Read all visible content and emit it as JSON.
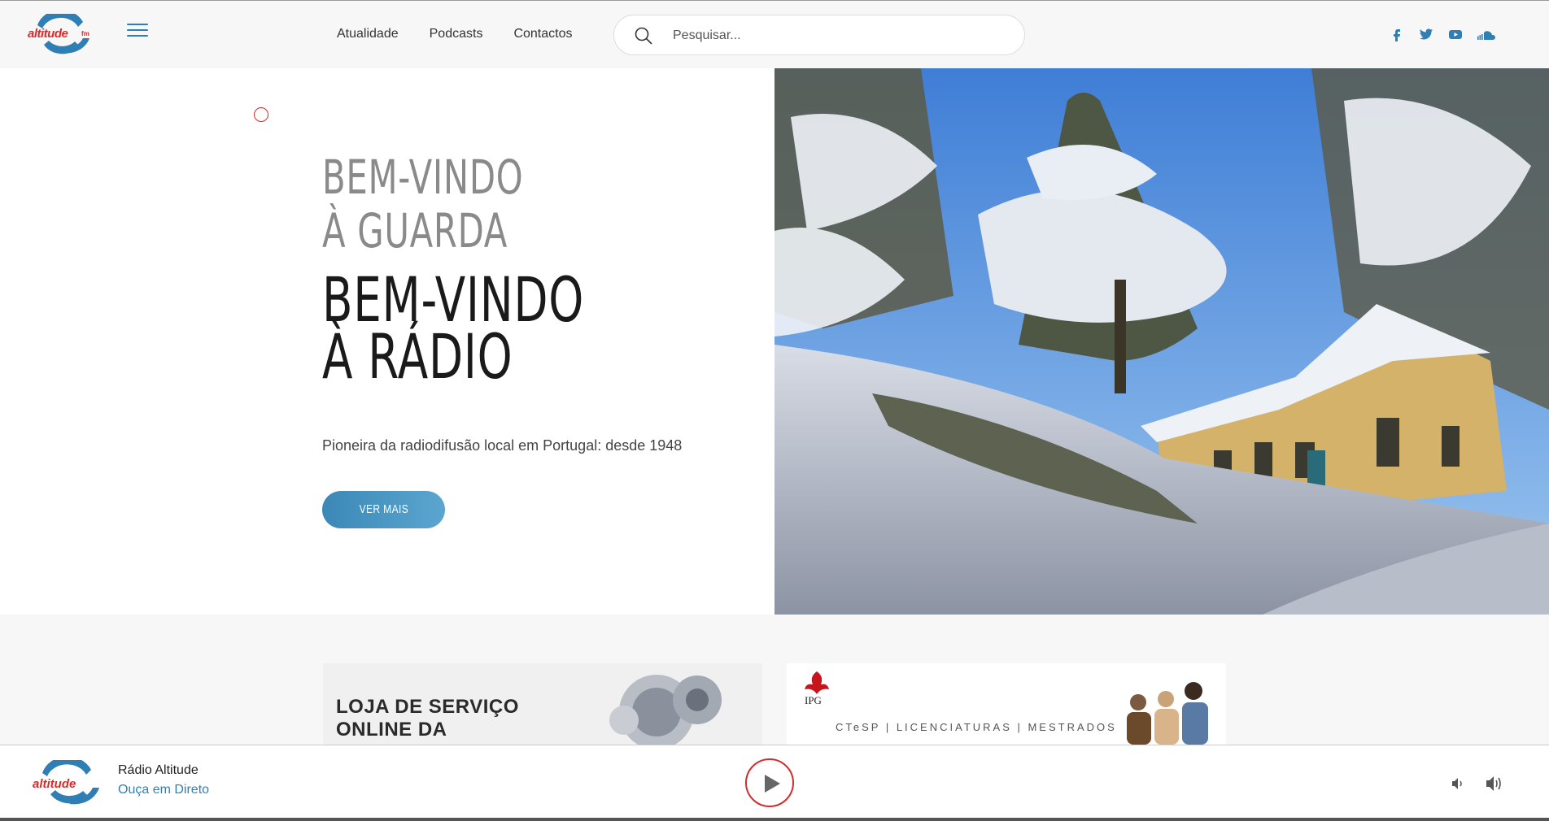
{
  "header": {
    "logo_text": "altitude",
    "logo_fm": "fm",
    "nav": [
      "Atualidade",
      "Podcasts",
      "Contactos"
    ],
    "search_placeholder": "Pesquisar...",
    "social_icons": [
      "facebook-icon",
      "twitter-icon",
      "youtube-icon",
      "soundcloud-icon"
    ]
  },
  "hero": {
    "title_grey_line1": "BEM-VINDO",
    "title_grey_line2": "À GUARDA",
    "title_dark_line1": "BEM-VINDO",
    "title_dark_line2": "À RÁDIO",
    "subtitle": "Pioneira da radiodifusão local em Portugal: desde 1948",
    "button_label": "VER MAIS"
  },
  "banners": {
    "banner1_line1": "LOJA DE SERVIÇO",
    "banner1_line2": "ONLINE DA",
    "banner2_logo": "IPG",
    "banner2_text": "CTeSP | LICENCIATURAS | MESTRADOS"
  },
  "player": {
    "station": "Rádio Altitude",
    "status": "Ouça em Direto"
  },
  "colors": {
    "accent_blue": "#2f7fb5",
    "accent_red": "#d62b2b"
  }
}
